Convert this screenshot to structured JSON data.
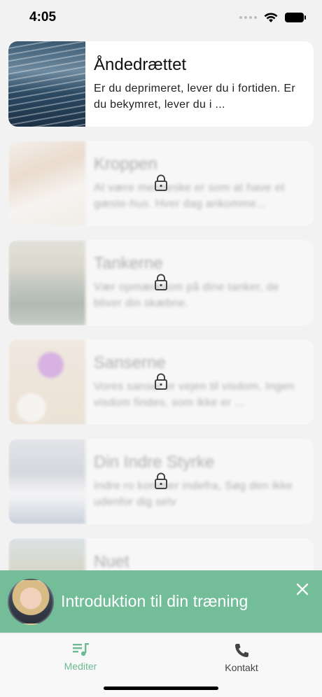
{
  "status_bar": {
    "time": "4:05"
  },
  "cards": [
    {
      "title": "Åndedrættet",
      "description": "Er du deprimeret, lever du i fortiden. Er du bekymret, lever du i ...",
      "locked": false,
      "thumb_icon": "ocean-water-image"
    },
    {
      "title": "Kroppen",
      "description": "At være menneske er som at have et gæste-hus. Hver dag ankomme...",
      "locked": true,
      "thumb_icon": "spa-body-image"
    },
    {
      "title": "Tankerne",
      "description": "Vær opmærksom på dine tanker, de bliver din skæbne.",
      "locked": true,
      "thumb_icon": "lake-image"
    },
    {
      "title": "Sanserne",
      "description": "Vores sanser er vejen til visdom. Ingen visdom findes, som ikke er ...",
      "locked": true,
      "thumb_icon": "orchid-image"
    },
    {
      "title": "Din Indre Styrke",
      "description": "Indre ro kommer indefra, Søg den ikke udenfor dig selv",
      "locked": true,
      "thumb_icon": "mountain-image"
    },
    {
      "title": "Nuet",
      "description": "",
      "locked": true,
      "thumb_icon": "tree-image"
    }
  ],
  "banner": {
    "text": "Introduktion til din træning",
    "accent": "#73bd98"
  },
  "tabs": [
    {
      "label": "Mediter",
      "icon": "playlist-music-icon",
      "active": true,
      "color": "#6dbb93"
    },
    {
      "label": "Kontakt",
      "icon": "phone-icon",
      "active": false,
      "color": "#444444"
    }
  ]
}
